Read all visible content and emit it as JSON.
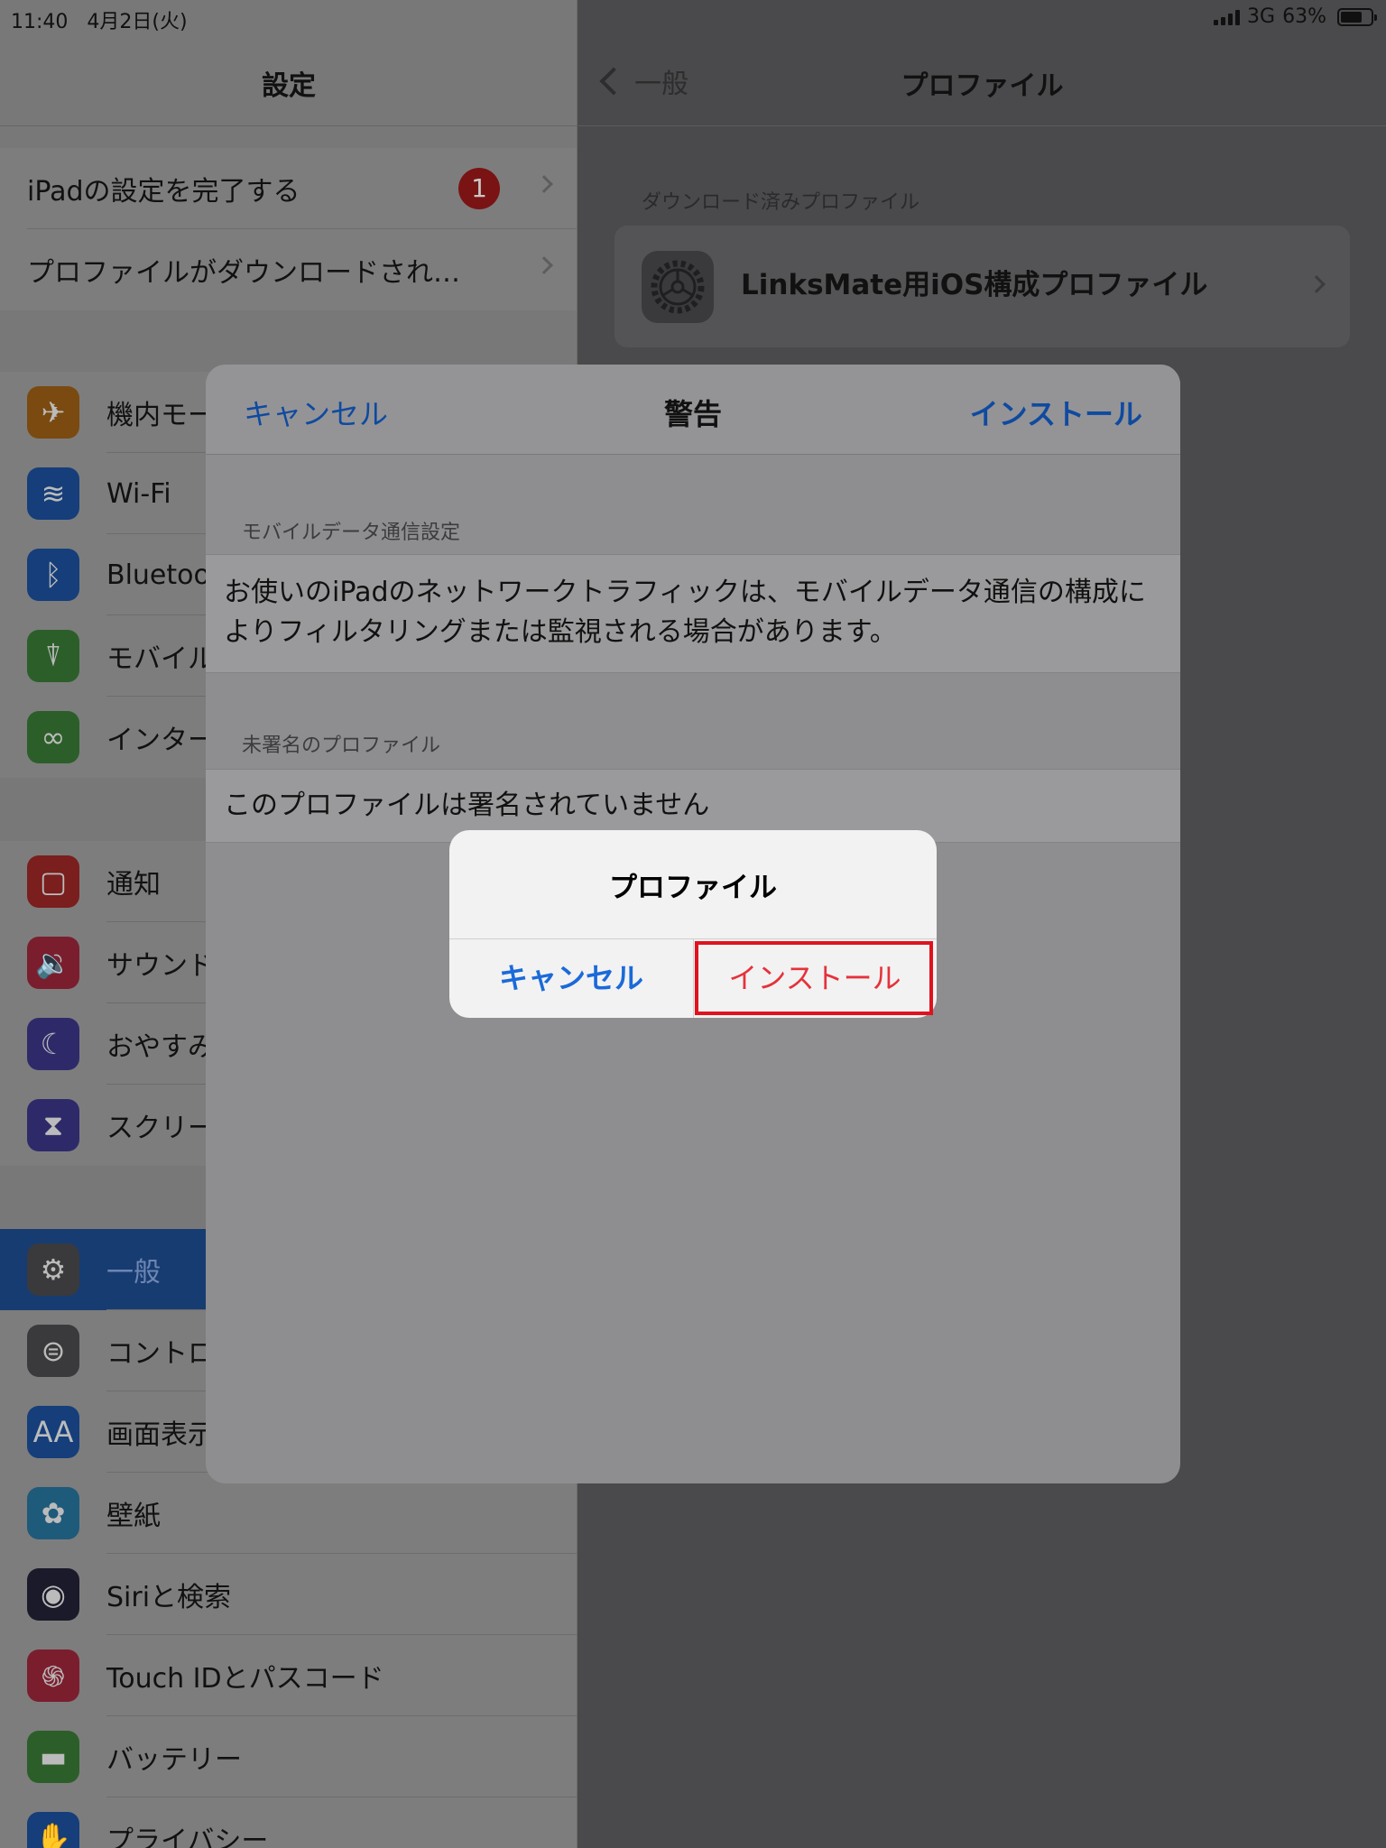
{
  "status_bar": {
    "time": "11:40",
    "date": "4月2日(火)",
    "network": "3G",
    "battery_percent": "63%",
    "battery_level": 0.63
  },
  "master": {
    "title": "設定",
    "setup_row": {
      "label": "iPadの設定を完了する",
      "badge": "1"
    },
    "profile_row": {
      "label": "プロファイルがダウンロードされ…"
    },
    "group1": [
      {
        "label": "機内モー",
        "icon": "airplane-icon",
        "color": "#7a4a10"
      },
      {
        "label": "Wi-Fi",
        "icon": "wifi-icon",
        "color": "#153e7a"
      },
      {
        "label": "Bluetoo",
        "icon": "bluetooth-icon",
        "color": "#153e7a"
      },
      {
        "label": "モバイル",
        "icon": "antenna-icon",
        "color": "#2c5e2a"
      },
      {
        "label": "インター",
        "icon": "link-icon",
        "color": "#2c5e2a"
      }
    ],
    "group2": [
      {
        "label": "通知",
        "icon": "notification-icon",
        "color": "#7a1e1e"
      },
      {
        "label": "サウンド",
        "icon": "speaker-icon",
        "color": "#7a1e2e"
      },
      {
        "label": "おやすみ",
        "icon": "moon-icon",
        "color": "#2e2a6a"
      },
      {
        "label": "スクリー",
        "icon": "hourglass-icon",
        "color": "#2e2a6a"
      }
    ],
    "group3": [
      {
        "label": "一般",
        "icon": "gear-icon",
        "color": "#3a3a3c",
        "selected": true
      },
      {
        "label": "コントロ",
        "icon": "toggles-icon",
        "color": "#3a3a3c"
      },
      {
        "label": "画面表示",
        "icon": "text-size-icon",
        "color": "#153e7a"
      },
      {
        "label": "壁紙",
        "icon": "flower-icon",
        "color": "#1e5a7a"
      },
      {
        "label": "Siriと検索",
        "icon": "siri-icon",
        "color": "#1a1a2a"
      },
      {
        "label": "Touch IDとパスコード",
        "icon": "fingerprint-icon",
        "color": "#7a1e2e"
      },
      {
        "label": "バッテリー",
        "icon": "battery-icon",
        "color": "#2c5e2a"
      },
      {
        "label": "プライバシー",
        "icon": "hand-icon",
        "color": "#153e7a"
      }
    ]
  },
  "detail": {
    "back_label": "一般",
    "title": "プロファイル",
    "section_header": "ダウンロード済みプロファイル",
    "profile_name": "LinksMate用iOS構成プロファイル"
  },
  "sheet": {
    "cancel": "キャンセル",
    "title": "警告",
    "install": "インストール",
    "mobile_header": "モバイルデータ通信設定",
    "mobile_text": "お使いのiPadのネットワークトラフィックは、モバイルデータ通信の構成によりフィルタリングまたは監視される場合があります。",
    "unsigned_header": "未署名のプロファイル",
    "unsigned_text": "このプロファイルは署名されていません"
  },
  "alert": {
    "title": "プロファイル",
    "cancel": "キャンセル",
    "install": "インストール",
    "highlight_color": "#e0121f"
  }
}
